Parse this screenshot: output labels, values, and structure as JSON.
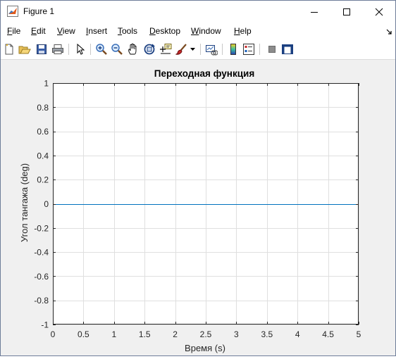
{
  "window": {
    "title": "Figure 1",
    "minimize_icon": "minimize-icon",
    "maximize_icon": "maximize-icon",
    "close_icon": "close-icon"
  },
  "menubar": {
    "items": [
      {
        "first": "F",
        "rest": "ile"
      },
      {
        "first": "E",
        "rest": "dit"
      },
      {
        "first": "V",
        "rest": "iew"
      },
      {
        "first": "I",
        "rest": "nsert"
      },
      {
        "first": "T",
        "rest": "ools"
      },
      {
        "first": "D",
        "rest": "esktop"
      },
      {
        "first": "W",
        "rest": "indow"
      },
      {
        "first": "H",
        "rest": "elp"
      }
    ]
  },
  "toolbar": {
    "icons": [
      "new-figure-icon",
      "open-file-icon",
      "save-icon",
      "print-icon",
      "edit-plot-arrow-icon",
      "zoom-in-icon",
      "zoom-out-icon",
      "pan-hand-icon",
      "rotate-3d-icon",
      "data-cursor-icon",
      "brush-icon",
      "link-plot-icon",
      "colorbar-icon",
      "legend-icon",
      "hide-plot-tools-icon",
      "show-plot-tools-icon"
    ]
  },
  "chart_data": {
    "type": "line",
    "title": "Переходная функция",
    "xlabel": "Время (s)",
    "ylabel": "Угол тангажа (deg)",
    "xlim": [
      0,
      5
    ],
    "ylim": [
      -1,
      1
    ],
    "grid": true,
    "x_ticks": [
      "0",
      "0.5",
      "1",
      "1.5",
      "2",
      "2.5",
      "3",
      "3.5",
      "4",
      "4.5",
      "5"
    ],
    "y_ticks": [
      "1",
      "0.8",
      "0.6",
      "0.4",
      "0.2",
      "0",
      "-0.2",
      "-0.4",
      "-0.6",
      "-0.8",
      "-1"
    ],
    "series": [
      {
        "color": "#0072bd",
        "x": [
          0,
          5
        ],
        "y": [
          0,
          0
        ]
      }
    ]
  }
}
